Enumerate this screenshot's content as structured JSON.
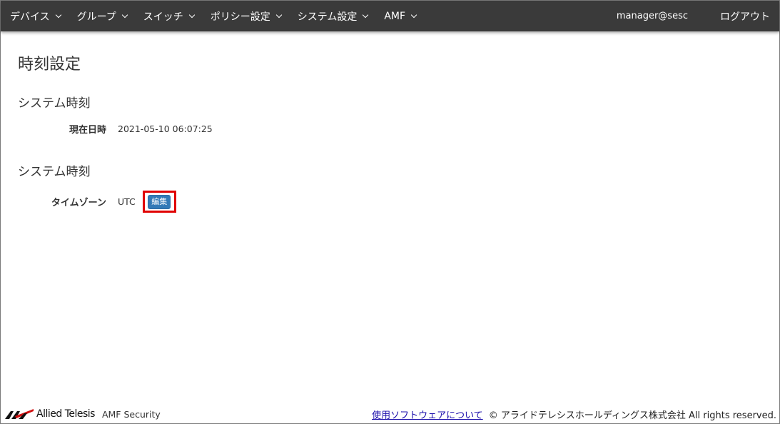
{
  "navbar": {
    "items": [
      {
        "label": "デバイス"
      },
      {
        "label": "グループ"
      },
      {
        "label": "スイッチ"
      },
      {
        "label": "ポリシー設定"
      },
      {
        "label": "システム設定"
      },
      {
        "label": "AMF"
      }
    ],
    "user": "manager@sesc",
    "logout_label": "ログアウト"
  },
  "main": {
    "page_title": "時刻設定",
    "section1": {
      "title": "システム時刻",
      "label": "現在日時",
      "value": "2021-05-10 06:07:25"
    },
    "section2": {
      "title": "システム時刻",
      "label": "タイムゾーン",
      "value": "UTC",
      "edit_label": "編集"
    }
  },
  "footer": {
    "brand": "Allied Telesis",
    "product": "AMF Security",
    "link_label": "使用ソフトウェアについて",
    "copyright": "© アライドテレシスホールディングス株式会社 All rights reserved."
  },
  "colors": {
    "navbar_bg": "#3a3a3a",
    "button_primary": "#337ab7",
    "highlight_box": "#e00000",
    "link": "#1a0dab"
  }
}
